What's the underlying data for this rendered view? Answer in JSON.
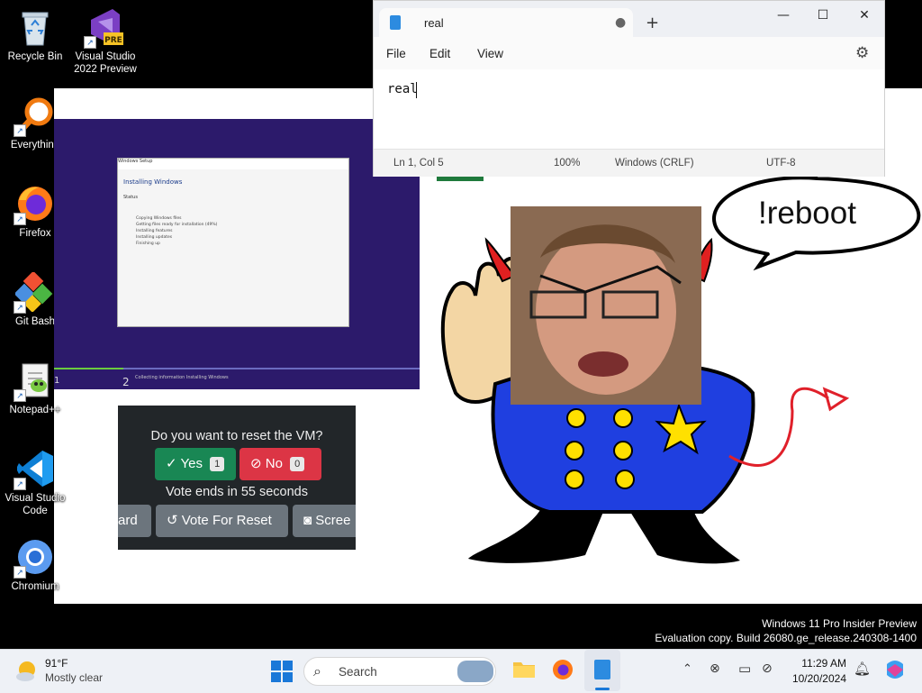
{
  "desktop": {
    "icons": [
      {
        "label": "Recycle Bin",
        "icon": "recycle-bin-icon"
      },
      {
        "label": "Visual Studio 2022 Preview",
        "icon": "visual-studio-preview-icon",
        "badge": "PRE"
      },
      {
        "label": "Everything",
        "icon": "everything-search-icon"
      },
      {
        "label": "Firefox",
        "icon": "firefox-icon"
      },
      {
        "label": "Git Bash",
        "icon": "git-bash-icon"
      },
      {
        "label": "Notepad++",
        "icon": "notepad-plus-plus-icon"
      },
      {
        "label": "Visual Studio Code",
        "icon": "vscode-icon"
      },
      {
        "label": "Chromium",
        "icon": "chromium-icon"
      }
    ]
  },
  "notepad": {
    "tab_title": "real",
    "new_tab": "+",
    "menu": {
      "file": "File",
      "edit": "Edit",
      "view": "View"
    },
    "content": "real",
    "status": {
      "position": "Ln 1, Col 5",
      "zoom": "100%",
      "line_ending": "Windows (CRLF)",
      "encoding": "UTF-8"
    },
    "controls": {
      "minimize": "—",
      "maximize": "☐",
      "close": "✕"
    }
  },
  "vm_screen": {
    "dialog_title": "Windows Setup",
    "heading": "Installing Windows",
    "status_label": "Status",
    "steps": [
      "Copying Windows files",
      "Getting files ready for installation (49%)",
      "Installing features",
      "Installing updates",
      "Finishing up"
    ],
    "bottom_text": "Collecting information   Installing Windows",
    "step_numbers": [
      "1",
      "2"
    ],
    "progress": 0.19
  },
  "vote_panel": {
    "question": "Do you want to reset the VM?",
    "yes_label": "Yes",
    "yes_count": "1",
    "no_label": "No",
    "no_count": "0",
    "ends_text": "Vote ends in 55 seconds",
    "buttons": [
      "ard",
      "Vote For Reset",
      "Scree"
    ],
    "colors": {
      "yes": "#198754",
      "no": "#dc3545",
      "secondary": "#6c757d"
    }
  },
  "cartoon": {
    "speech": "!reboot"
  },
  "watermark": {
    "line1": "Windows 11 Pro Insider Preview",
    "line2": "Evaluation copy. Build 26080.ge_release.240308-1400"
  },
  "taskbar": {
    "weather_temp": "91°F",
    "weather_desc": "Mostly clear",
    "search_placeholder": "Search",
    "time": "11:29 AM",
    "date": "10/20/2024"
  }
}
